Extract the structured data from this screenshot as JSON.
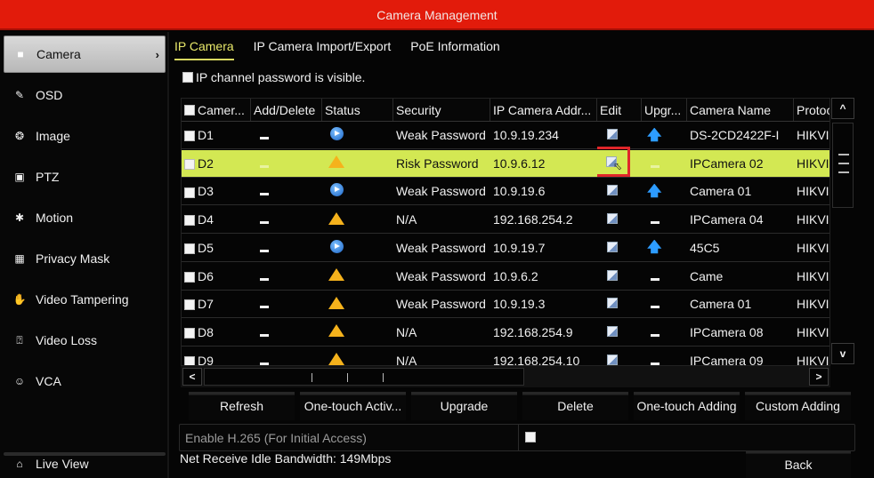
{
  "window": {
    "title": "Camera Management"
  },
  "sidebar": {
    "items": [
      {
        "label": "Camera",
        "icon": "camera-icon",
        "active": true
      },
      {
        "label": "OSD",
        "icon": "osd-icon"
      },
      {
        "label": "Image",
        "icon": "image-icon"
      },
      {
        "label": "PTZ",
        "icon": "ptz-icon"
      },
      {
        "label": "Motion",
        "icon": "motion-icon"
      },
      {
        "label": "Privacy Mask",
        "icon": "privacy-mask-icon"
      },
      {
        "label": "Video Tampering",
        "icon": "hand-icon"
      },
      {
        "label": "Video Loss",
        "icon": "question-box-icon"
      },
      {
        "label": "VCA",
        "icon": "head-icon"
      }
    ],
    "live_view": {
      "label": "Live View",
      "icon": "home-icon"
    }
  },
  "tabs": [
    {
      "label": "IP Camera",
      "active": true
    },
    {
      "label": "IP Camera Import/Export"
    },
    {
      "label": "PoE Information"
    }
  ],
  "password_visible": {
    "label": "IP channel password is visible.",
    "checked": false
  },
  "table": {
    "columns": [
      "Camer...",
      "Add/Delete",
      "Status",
      "Security",
      "IP Camera Addr...",
      "Edit",
      "Upgr...",
      "Camera Name",
      "Protoc"
    ],
    "rows": [
      {
        "channel": "D1",
        "add_delete": "-",
        "status": "play",
        "security": "Weak Password",
        "ip": "10.9.19.234",
        "edit": "edit",
        "upgrade": "up",
        "name": "DS-2CD2422F-I",
        "protocol": "HIKVIS"
      },
      {
        "channel": "D2",
        "add_delete": "-",
        "status": "warning",
        "security": "Risk Password",
        "ip": "10.9.6.12",
        "edit": "edit",
        "upgrade": "-",
        "name": "IPCamera 02",
        "protocol": "HIKVIS",
        "selected": true
      },
      {
        "channel": "D3",
        "add_delete": "-",
        "status": "play",
        "security": "Weak Password",
        "ip": "10.9.19.6",
        "edit": "edit",
        "upgrade": "up",
        "name": "Camera 01",
        "protocol": "HIKVIS"
      },
      {
        "channel": "D4",
        "add_delete": "-",
        "status": "warning",
        "security": "N/A",
        "ip": "192.168.254.2",
        "edit": "edit",
        "upgrade": "-",
        "name": "IPCamera 04",
        "protocol": "HIKVIS"
      },
      {
        "channel": "D5",
        "add_delete": "-",
        "status": "play",
        "security": "Weak Password",
        "ip": "10.9.19.7",
        "edit": "edit",
        "upgrade": "up",
        "name": "45C5",
        "protocol": "HIKVIS"
      },
      {
        "channel": "D6",
        "add_delete": "-",
        "status": "warning",
        "security": "Weak Password",
        "ip": "10.9.6.2",
        "edit": "edit",
        "upgrade": "-",
        "name": "Came",
        "protocol": "HIKVIS"
      },
      {
        "channel": "D7",
        "add_delete": "-",
        "status": "warning",
        "security": "Weak Password",
        "ip": "10.9.19.3",
        "edit": "edit",
        "upgrade": "-",
        "name": "Camera 01",
        "protocol": "HIKVIS"
      },
      {
        "channel": "D8",
        "add_delete": "-",
        "status": "warning",
        "security": "N/A",
        "ip": "192.168.254.9",
        "edit": "edit",
        "upgrade": "-",
        "name": "IPCamera 08",
        "protocol": "HIKVIS"
      },
      {
        "channel": "D9",
        "add_delete": "-",
        "status": "warning",
        "security": "N/A",
        "ip": "192.168.254.10",
        "edit": "edit",
        "upgrade": "-",
        "name": "IPCamera 09",
        "protocol": "HIKVIS"
      }
    ]
  },
  "scroll": {
    "up": "^",
    "down": "v",
    "left": "<",
    "right": ">"
  },
  "buttons": [
    "Refresh",
    "One-touch Activ...",
    "Upgrade",
    "Delete",
    "One-touch Adding",
    "Custom Adding"
  ],
  "h265": {
    "label": "Enable H.265 (For Initial Access)",
    "checked": false
  },
  "bandwidth": "Net Receive Idle Bandwidth: 149Mbps",
  "back_label": "Back",
  "colors": {
    "title_bar": "#e21b0b",
    "selected_row": "#d3e853",
    "active_tab": "#e8e86a",
    "highlight_box": "#e0262a"
  }
}
